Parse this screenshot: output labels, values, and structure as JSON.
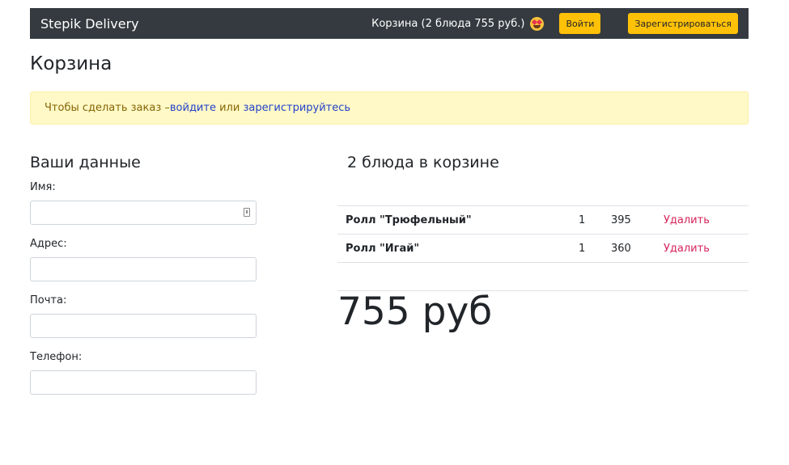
{
  "navbar": {
    "brand": "Stepik Delivery",
    "cart_summary": "Корзина (2 блюда 755 руб.)",
    "cart_icon": "heart-eyes-emoji-icon",
    "login_label": "Войти",
    "register_label": "Зарегистрироваться",
    "button_color": "#ffc107",
    "bg_color": "#343a40"
  },
  "page": {
    "title": "Корзина"
  },
  "alert": {
    "prefix": "Чтобы сделать заказ – ",
    "login_link": "войдите",
    "middle": " или ",
    "register_link": "зарегистрируйтесь"
  },
  "form": {
    "title": "Ваши данные",
    "fields": [
      {
        "label": "Имя:",
        "value": ""
      },
      {
        "label": "Адрес:",
        "value": ""
      },
      {
        "label": "Почта:",
        "value": ""
      },
      {
        "label": "Телефон:",
        "value": ""
      }
    ]
  },
  "cart": {
    "title": "2 блюда в корзине",
    "items": [
      {
        "name": "Ролл \"Трюфельный\"",
        "qty": "1",
        "price": "395",
        "delete_label": "Удалить"
      },
      {
        "name": "Ролл \"Игай\"",
        "qty": "1",
        "price": "360",
        "delete_label": "Удалить"
      }
    ],
    "total": "755 руб"
  }
}
